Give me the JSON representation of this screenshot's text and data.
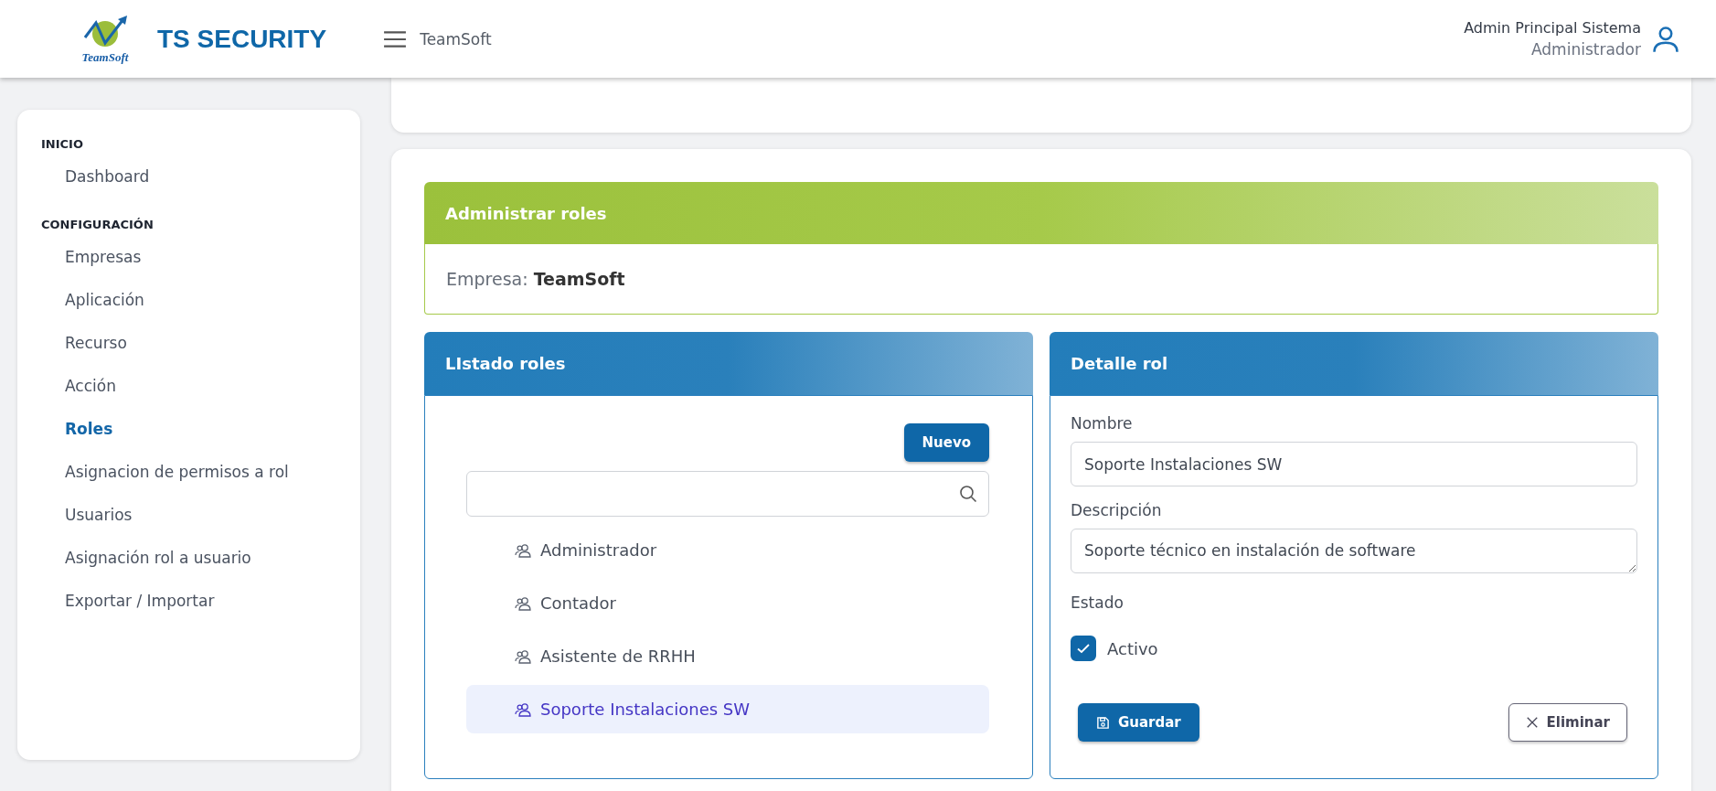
{
  "header": {
    "brand_logo_text": "TeamSoft",
    "app_title": "TS SECURITY",
    "company": "TeamSoft",
    "user_name": "Admin Principal Sistema",
    "user_role": "Administrador"
  },
  "sidebar": {
    "sections": [
      {
        "title": "INICIO",
        "items": [
          {
            "label": "Dashboard",
            "selected": false
          }
        ]
      },
      {
        "title": "CONFIGURACIÓN",
        "items": [
          {
            "label": "Empresas",
            "selected": false
          },
          {
            "label": "Aplicación",
            "selected": false
          },
          {
            "label": "Recurso",
            "selected": false
          },
          {
            "label": "Acción",
            "selected": false
          },
          {
            "label": "Roles",
            "selected": true
          },
          {
            "label": "Asignacion de permisos a rol",
            "selected": false
          },
          {
            "label": "Usuarios",
            "selected": false
          },
          {
            "label": "Asignación rol a usuario",
            "selected": false
          },
          {
            "label": "Exportar / Importar",
            "selected": false
          }
        ]
      }
    ]
  },
  "admin_panel": {
    "title": "Administrar roles",
    "company_label": "Empresa:",
    "company_value": "TeamSoft"
  },
  "roles_list": {
    "title": "LIstado roles",
    "new_button": "Nuevo",
    "roles": [
      {
        "label": "Administrador",
        "selected": false
      },
      {
        "label": "Contador",
        "selected": false
      },
      {
        "label": "Asistente de RRHH",
        "selected": false
      },
      {
        "label": "Soporte Instalaciones SW",
        "selected": true
      }
    ]
  },
  "role_detail": {
    "title": "Detalle rol",
    "name_label": "Nombre",
    "name_value": "Soporte Instalaciones SW",
    "description_label": "Descripción",
    "description_value": "Soporte técnico en instalación de software",
    "status_label": "Estado",
    "active_label": "Activo",
    "active": true,
    "save_button": "Guardar",
    "delete_button": "Eliminar"
  }
}
